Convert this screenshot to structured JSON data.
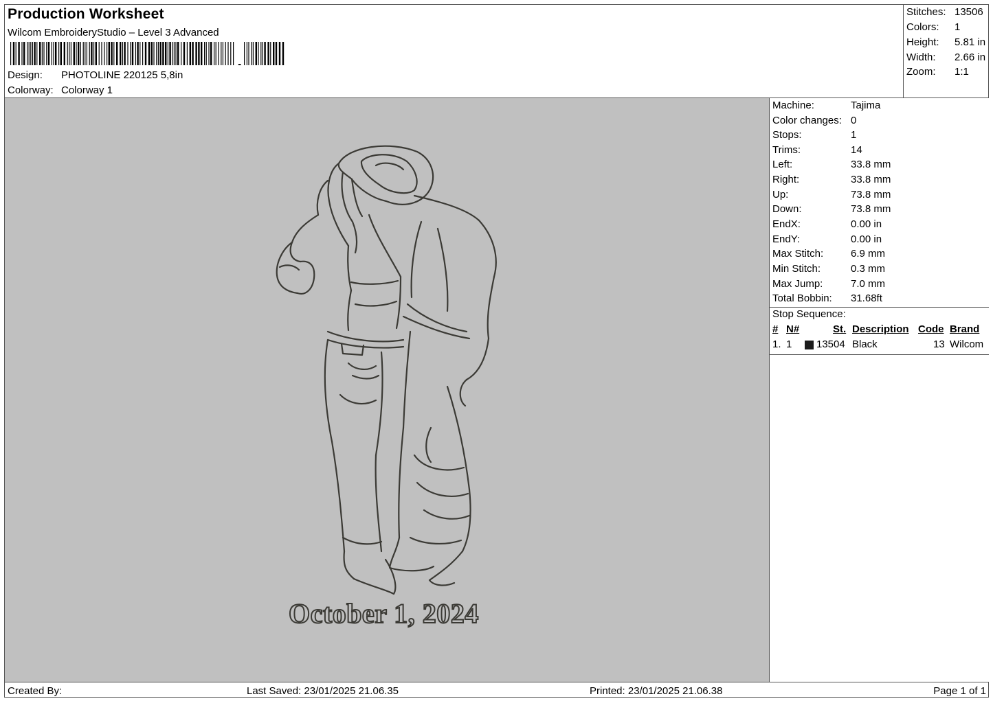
{
  "header": {
    "title": "Production Worksheet",
    "subtitle": "Wilcom EmbroideryStudio – Level 3 Advanced",
    "barcode_text": ",",
    "design_label": "Design:",
    "design_value": "PHOTOLINE 220125 5,8in",
    "colorway_label": "Colorway:",
    "colorway_value": "Colorway 1"
  },
  "summary": {
    "rows": [
      {
        "label": "Stitches:",
        "value": "13506"
      },
      {
        "label": "Colors:",
        "value": "1"
      },
      {
        "label": "Height:",
        "value": "5.81 in"
      },
      {
        "label": "Width:",
        "value": "2.66 in"
      },
      {
        "label": "Zoom:",
        "value": "1:1"
      }
    ]
  },
  "design": {
    "date_text": "October 1, 2024",
    "thread_color": "#3b3a35",
    "background_color": "#c0c0c0"
  },
  "machine_info": {
    "rows": [
      {
        "label": "Machine:",
        "value": "Tajima"
      },
      {
        "label": "Color changes:",
        "value": "0"
      },
      {
        "label": "Stops:",
        "value": "1"
      },
      {
        "label": "Trims:",
        "value": "14"
      },
      {
        "label": "Left:",
        "value": "33.8 mm"
      },
      {
        "label": "Right:",
        "value": "33.8 mm"
      },
      {
        "label": "Up:",
        "value": "73.8 mm"
      },
      {
        "label": "Down:",
        "value": "73.8 mm"
      },
      {
        "label": "EndX:",
        "value": "0.00 in"
      },
      {
        "label": "EndY:",
        "value": "0.00 in"
      },
      {
        "label": "Max Stitch:",
        "value": "6.9 mm"
      },
      {
        "label": "Min Stitch:",
        "value": "0.3 mm"
      },
      {
        "label": "Max Jump:",
        "value": "7.0 mm"
      },
      {
        "label": "Total Bobbin:",
        "value": "31.68ft"
      }
    ]
  },
  "stop_sequence": {
    "title": "Stop Sequence:",
    "headers": [
      "#",
      "N#",
      "St.",
      "Description",
      "Code",
      "Brand"
    ],
    "rows": [
      {
        "num": "1.",
        "n": "1",
        "st": "13504",
        "description": "Black",
        "code": "13",
        "brand": "Wilcom",
        "swatch": "#1c1c1c"
      }
    ]
  },
  "footer": {
    "created_by": "Created By:",
    "last_saved": "Last Saved: 23/01/2025 21.06.35",
    "printed": "Printed: 23/01/2025 21.06.38",
    "page": "Page 1 of 1"
  }
}
